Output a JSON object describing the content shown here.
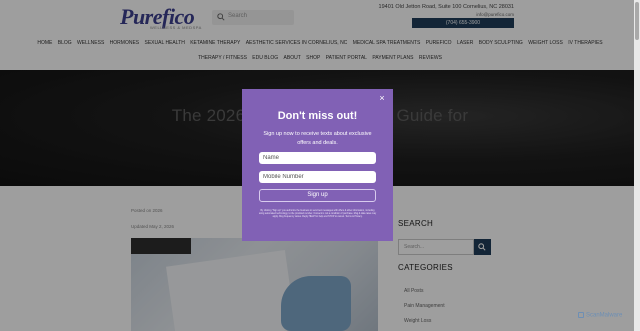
{
  "header": {
    "logo_text": "Purefico",
    "logo_tagline": "WELLNESS & MEDSPA",
    "search_placeholder": "Search",
    "address": "19401 Old Jetton Road, Suite 100 Cornelius, NC 28031",
    "email": "info@purefico.com",
    "phone_button": "(704) 655-3900"
  },
  "nav": {
    "row1": [
      "HOME",
      "BLOG",
      "WELLNESS",
      "HORMONES",
      "SEXUAL HEALTH",
      "KETAMINE THERAPY",
      "AESTHETIC SERVICES IN CORNELIUS, NC",
      "MEDICAL SPA TREATMENTS",
      "PUREFICO",
      "LASER",
      "BODY SCULPTING",
      "WEIGHT LOSS",
      "IV THERAPIES"
    ],
    "row2": [
      "THERAPY / FITNESS",
      "EDU BLOG",
      "ABOUT",
      "SHOP",
      "PATIENT PORTAL",
      "PAYMENT PLANS",
      "REVIEWS"
    ]
  },
  "hero": {
    "title": "The 2026 FDA Regulation: A Guide for"
  },
  "post": {
    "meta_published": "Posted on 2026",
    "meta_updated": "Updated May 2, 2026"
  },
  "sidebar": {
    "search_heading": "SEARCH",
    "search_placeholder": "Search...",
    "categories_heading": "CATEGORIES",
    "categories": [
      "All Posts",
      "Pain Management",
      "Weight Loss"
    ]
  },
  "popup": {
    "title": "Don't miss out!",
    "description": "Sign up now to receive texts about exclusive offers and deals.",
    "name_placeholder": "Name",
    "mobile_placeholder": "Mobile Number",
    "signup_label": "Sign up",
    "close_symbol": "×",
    "legal_text": "By clicking \"Sign up\" you authorize the business to send text messages with offers & other information, including using automated technology, to the provided number. Consent is not a condition of purchase. Msg & data rates may apply. Msg frequency varies. Reply HELP for help and STOP to cancel. Terms & Privacy."
  },
  "watermark": {
    "text": "ScanMalware"
  },
  "colors": {
    "popup_bg": "#8161b5",
    "brand_navy": "#1f3d5a",
    "logo": "#3d3f8f"
  }
}
